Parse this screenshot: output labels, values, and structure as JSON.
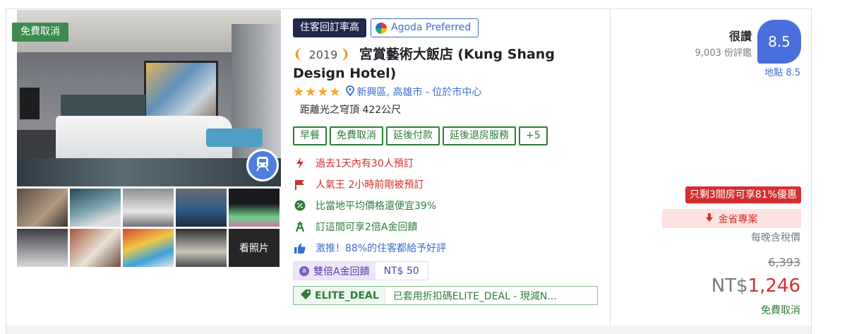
{
  "photo": {
    "free_cancel_badge": "免費取消",
    "more_photos_label": "看照片"
  },
  "tags": {
    "repeat_rate": "住客回訂率高",
    "agoda_preferred": "Agoda Preferred"
  },
  "hotel": {
    "award_year": "2019",
    "name": "宮賞藝術大飯店 (Kung Shang Design Hotel)",
    "stars": "★★★★",
    "location": "新興區, 高雄市 - 位於市中心",
    "distance": "距離光之穹頂 422公尺"
  },
  "features": [
    "早餐",
    "免費取消",
    "延後付款",
    "延後退房服務",
    "+5"
  ],
  "perks": [
    {
      "text": "過去1天內有30人預訂",
      "icon": "lightning-icon"
    },
    {
      "text": "人氣王 2小時前剛被預訂",
      "icon": "flag-icon"
    },
    {
      "text": "比當地平均價格還便宜39%",
      "icon": "discount-badge-icon"
    },
    {
      "text": "訂這間可享2倍A金回饋",
      "icon": "coin-a-icon"
    },
    {
      "text": "激推！88%的住客都給予好評",
      "icon": "thumbs-up-icon"
    }
  ],
  "cashback": {
    "label": "雙倍A金回饋",
    "amount": "NT$ 50"
  },
  "coupon": {
    "code": "ELITE_DEAL",
    "message": "已套用折扣碼ELITE_DEAL - 現減N..."
  },
  "review": {
    "word": "很讚",
    "count": "9,003 份評鑑",
    "score": "8.5",
    "location_score": "地點 8.5"
  },
  "pricing": {
    "urgency": "只剩3間房可享81%優惠",
    "saver_label": "金省專案",
    "per_night_note": "每晚含稅價",
    "original_price": "6,393",
    "currency": "NT$",
    "price": "1,246",
    "free_cancel": "免費取消"
  },
  "colors": {
    "green": "#2e7d3a",
    "red": "#d42f2f",
    "blue": "#3b6ec9",
    "navy": "#20274d",
    "score_blue": "#4a6fdc"
  }
}
